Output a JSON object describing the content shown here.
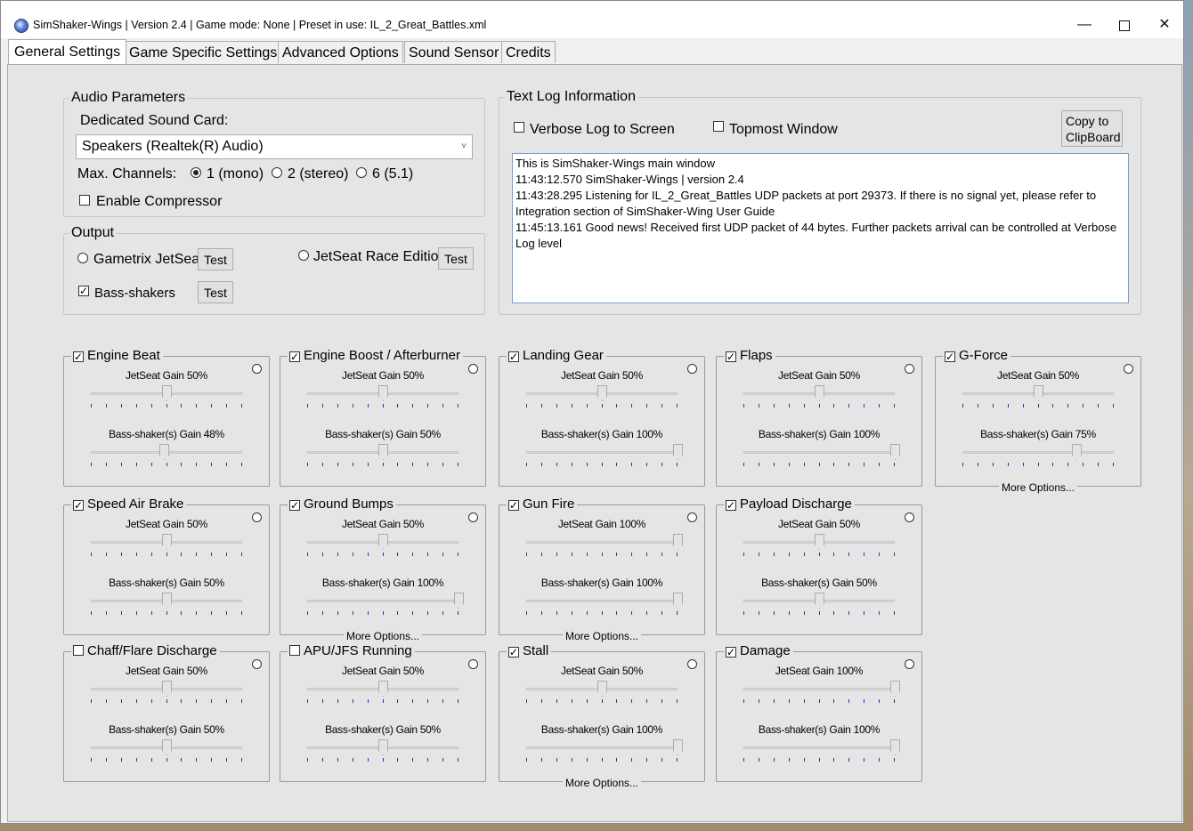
{
  "window": {
    "title": "SimShaker-Wings | Version 2.4 | Game mode: None | Preset in use: IL_2_Great_Battles.xml",
    "minimize": "—",
    "close": "✕"
  },
  "tabs": [
    {
      "label": "General Settings",
      "active": true
    },
    {
      "label": "Game Specific Settings"
    },
    {
      "label": "Advanced Options"
    },
    {
      "label": "Sound Sensor"
    },
    {
      "label": "Credits"
    }
  ],
  "audio": {
    "legend": "Audio Parameters",
    "card_label": "Dedicated Sound Card:",
    "card_value": "Speakers (Realtek(R) Audio)",
    "channels_label": "Max. Channels:",
    "channels": [
      "1 (mono)",
      "2 (stereo)",
      "6 (5.1)"
    ],
    "channels_selected": 0,
    "compressor_label": "Enable Compressor",
    "compressor_checked": false
  },
  "output": {
    "legend": "Output",
    "gametrix_label": "Gametrix JetSeat",
    "race_label": "JetSeat Race Edition",
    "bass_label": "Bass-shakers",
    "bass_checked": true,
    "test_label": "Test"
  },
  "log": {
    "legend": "Text Log Information",
    "verbose_label": "Verbose Log to Screen",
    "topmost_label": "Topmost Window",
    "copy_label": "Copy to ClipBoard",
    "lines": [
      "This is SimShaker-Wings main window",
      "11:43:12.570 SimShaker-Wings | version 2.4",
      "11:43:28.295 Listening for IL_2_Great_Battles UDP packets at port 29373. If there is no signal yet, please refer to Integration section of SimShaker-Wing User Guide",
      "11:45:13.161 Good news! Received first UDP packet of 44 bytes. Further packets arrival can be controlled at Verbose Log level"
    ]
  },
  "more_options_label": "More Options...",
  "effects": [
    {
      "name": "Engine Beat",
      "checked": true,
      "jetseat_label": "JetSeat Gain 50%",
      "jetseat": 50,
      "bass_label": "Bass-shaker(s) Gain 48%",
      "bass": 48,
      "more": false
    },
    {
      "name": "Engine Boost / Afterburner",
      "checked": true,
      "jetseat_label": "JetSeat Gain 50%",
      "jetseat": 50,
      "bass_label": "Bass-shaker(s) Gain 50%",
      "bass": 50,
      "more": false
    },
    {
      "name": "Landing Gear",
      "checked": true,
      "jetseat_label": "JetSeat Gain 50%",
      "jetseat": 50,
      "bass_label": "Bass-shaker(s) Gain 100%",
      "bass": 100,
      "more": false
    },
    {
      "name": "Flaps",
      "checked": true,
      "jetseat_label": "JetSeat Gain 50%",
      "jetseat": 50,
      "bass_label": "Bass-shaker(s) Gain 100%",
      "bass": 100,
      "more": false
    },
    {
      "name": "G-Force",
      "checked": true,
      "jetseat_label": "JetSeat Gain 50%",
      "jetseat": 50,
      "bass_label": "Bass-shaker(s) Gain 75%",
      "bass": 75,
      "more": true
    },
    {
      "name": "Speed Air Brake",
      "checked": true,
      "jetseat_label": "JetSeat Gain 50%",
      "jetseat": 50,
      "bass_label": "Bass-shaker(s) Gain 50%",
      "bass": 50,
      "more": false
    },
    {
      "name": "Ground Bumps",
      "checked": true,
      "jetseat_label": "JetSeat Gain 50%",
      "jetseat": 50,
      "bass_label": "Bass-shaker(s) Gain 100%",
      "bass": 100,
      "more": true
    },
    {
      "name": "Gun Fire",
      "checked": true,
      "jetseat_label": "JetSeat Gain 100%",
      "jetseat": 100,
      "bass_label": "Bass-shaker(s) Gain 100%",
      "bass": 100,
      "more": true
    },
    {
      "name": "Payload Discharge",
      "checked": true,
      "jetseat_label": "JetSeat Gain 50%",
      "jetseat": 50,
      "bass_label": "Bass-shaker(s) Gain 50%",
      "bass": 50,
      "more": false
    },
    {
      "name": "Chaff/Flare Discharge",
      "checked": false,
      "jetseat_label": "JetSeat Gain 50%",
      "jetseat": 50,
      "bass_label": "Bass-shaker(s) Gain 50%",
      "bass": 50,
      "more": false
    },
    {
      "name": "APU/JFS Running",
      "checked": false,
      "jetseat_label": "JetSeat Gain 50%",
      "jetseat": 50,
      "bass_label": "Bass-shaker(s) Gain 50%",
      "bass": 50,
      "more": false
    },
    {
      "name": "Stall",
      "checked": true,
      "jetseat_label": "JetSeat Gain 50%",
      "jetseat": 50,
      "bass_label": "Bass-shaker(s) Gain 100%",
      "bass": 100,
      "more": true
    },
    {
      "name": "Damage",
      "checked": true,
      "jetseat_label": "JetSeat Gain 100%",
      "jetseat": 100,
      "bass_label": "Bass-shaker(s) Gain 100%",
      "bass": 100,
      "more": false
    }
  ]
}
